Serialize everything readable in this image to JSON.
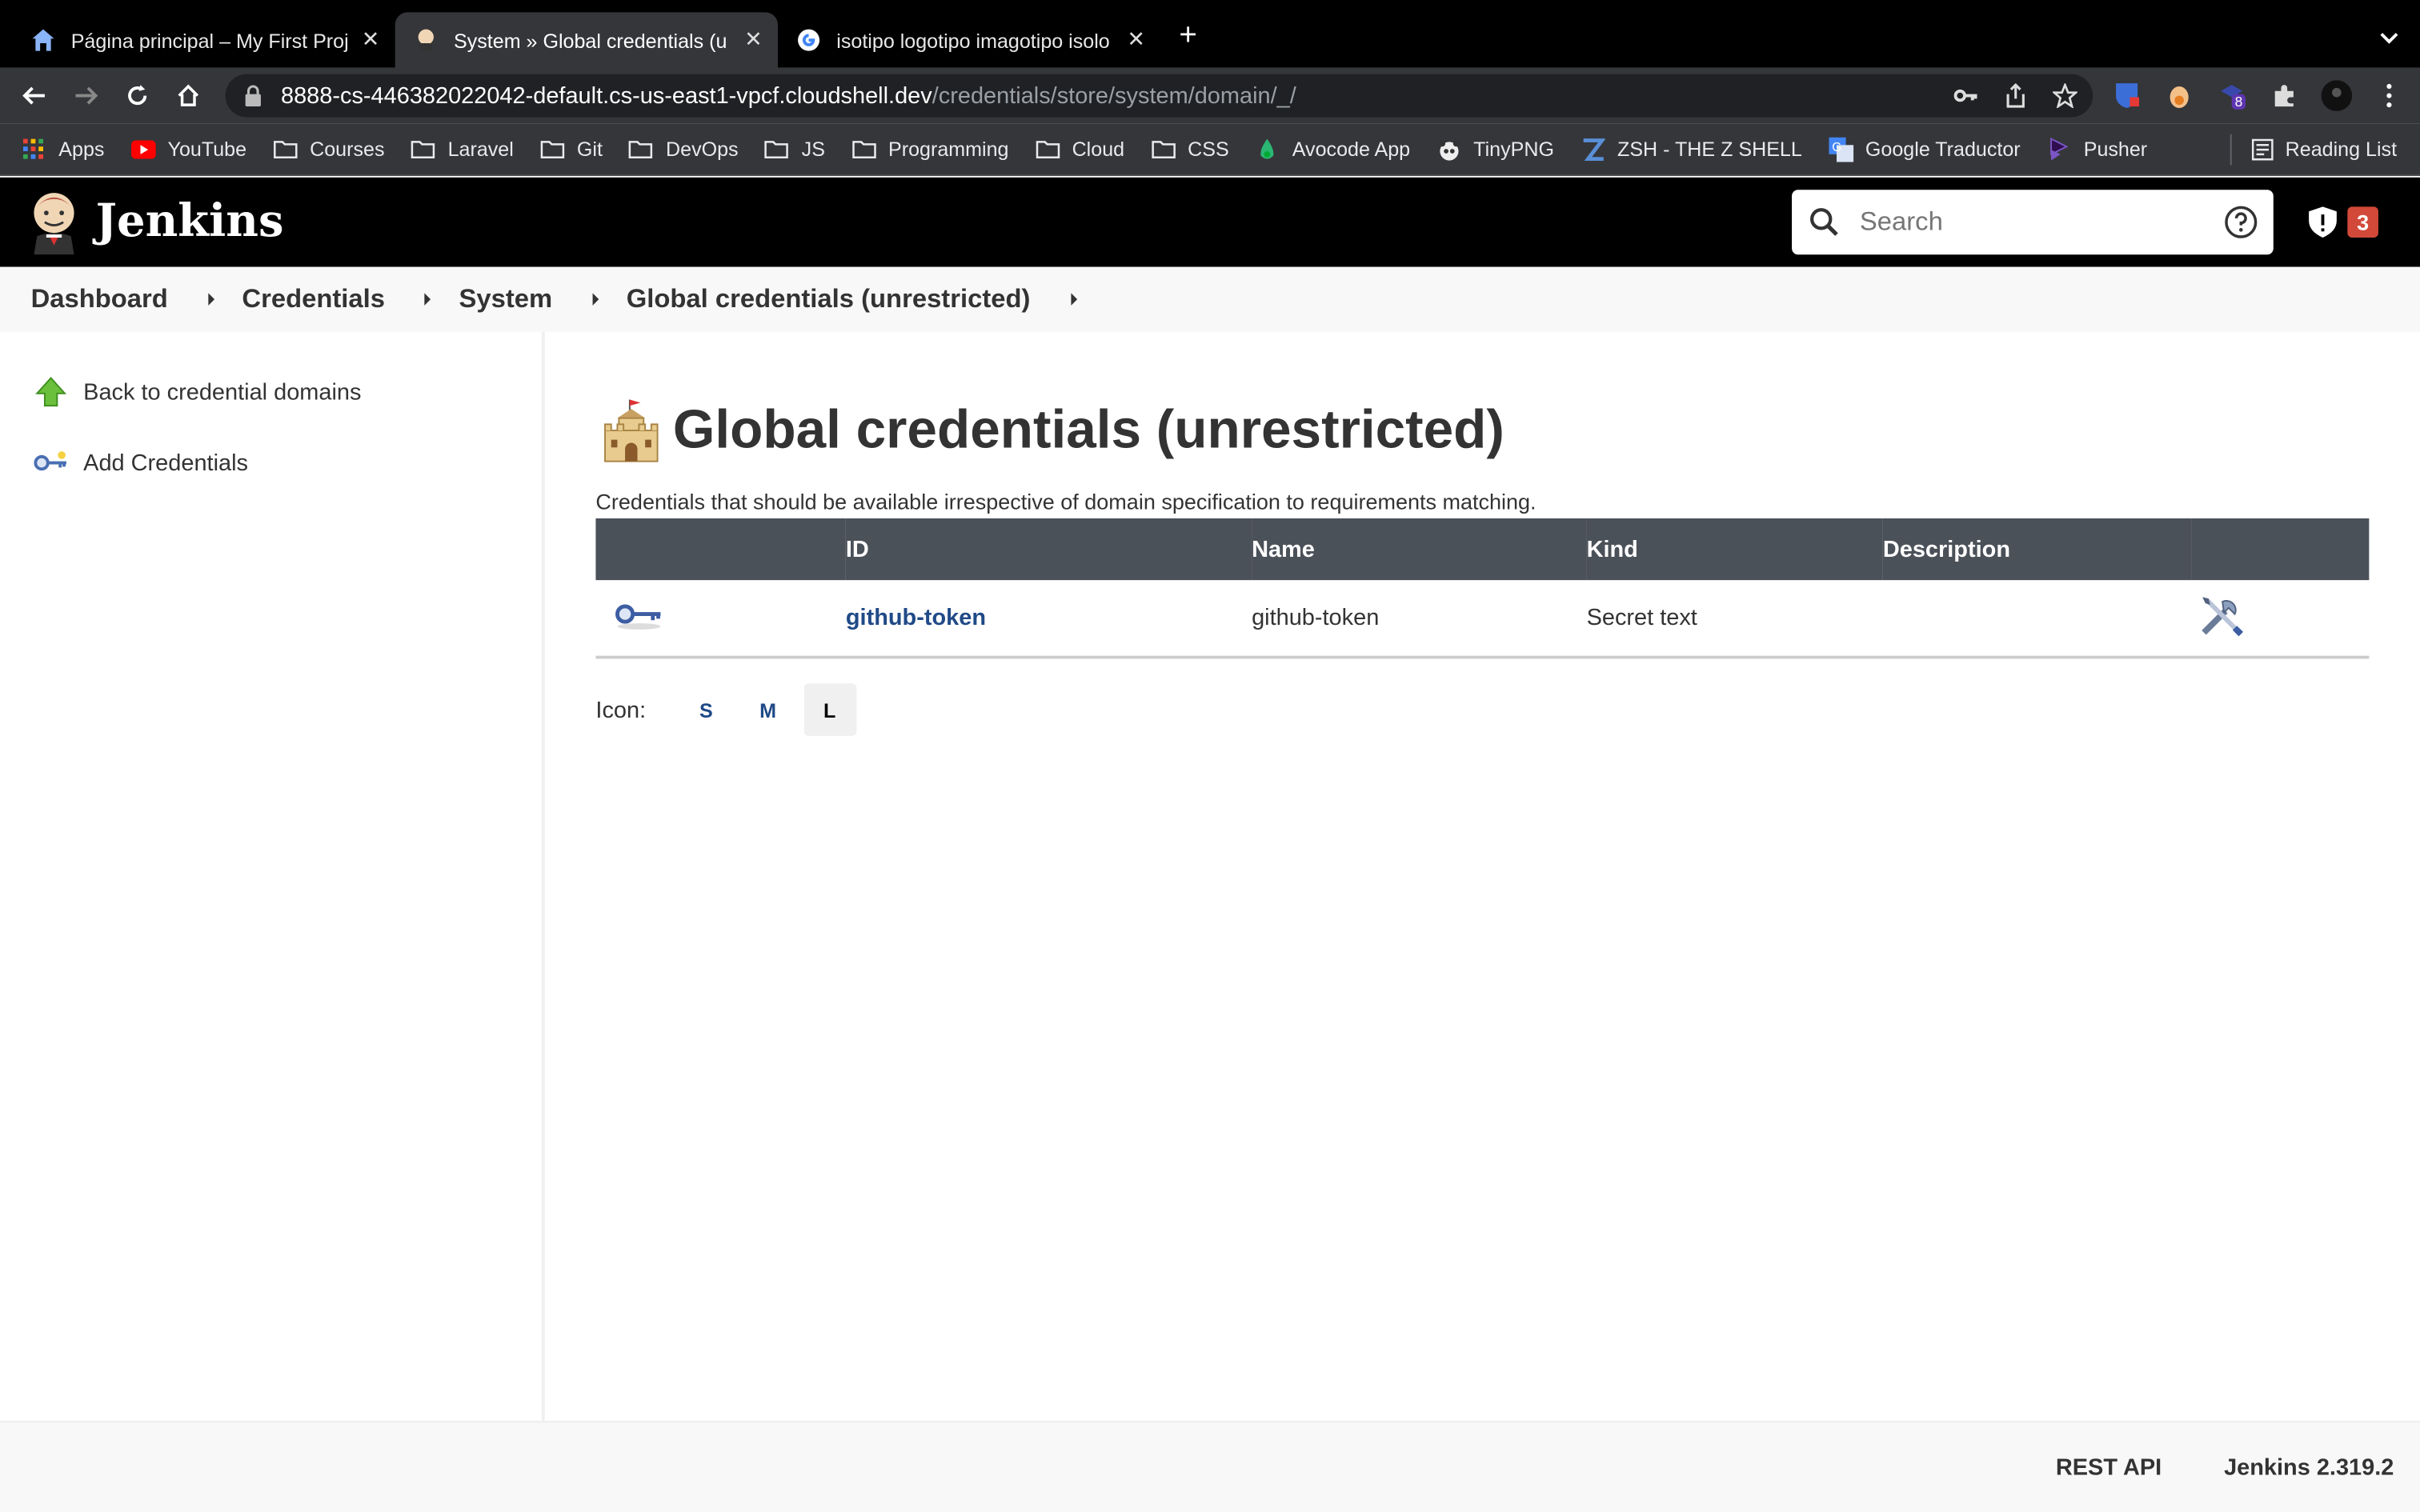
{
  "browser": {
    "tabs": [
      {
        "title": "Página principal – My First Proj",
        "icon": "home-icon"
      },
      {
        "title": "System » Global credentials (u",
        "icon": "jenkins-favicon"
      },
      {
        "title": "isotipo logotipo imagotipo isolo",
        "icon": "google-icon"
      }
    ],
    "url_host": "8888-cs-446382022042-default.cs-us-east1-vpcf.cloudshell.dev",
    "url_path": "/credentials/store/system/domain/_/",
    "extension_badge": "8",
    "bookmarks": [
      {
        "label": "Apps",
        "icon": "apps-grid-icon"
      },
      {
        "label": "YouTube",
        "icon": "youtube-icon"
      },
      {
        "label": "Courses",
        "icon": "folder-icon"
      },
      {
        "label": "Laravel",
        "icon": "folder-icon"
      },
      {
        "label": "Git",
        "icon": "folder-icon"
      },
      {
        "label": "DevOps",
        "icon": "folder-icon"
      },
      {
        "label": "JS",
        "icon": "folder-icon"
      },
      {
        "label": "Programming",
        "icon": "folder-icon"
      },
      {
        "label": "Cloud",
        "icon": "folder-icon"
      },
      {
        "label": "CSS",
        "icon": "folder-icon"
      },
      {
        "label": "Avocode App",
        "icon": "avocode-icon"
      },
      {
        "label": "TinyPNG",
        "icon": "panda-icon"
      },
      {
        "label": "ZSH - THE Z SHELL",
        "icon": "zsh-icon"
      },
      {
        "label": "Google Traductor",
        "icon": "translate-icon"
      },
      {
        "label": "Pusher",
        "icon": "pusher-icon"
      }
    ],
    "reading_list": "Reading List"
  },
  "header": {
    "title": "Jenkins",
    "search_placeholder": "Search",
    "security_count": "3"
  },
  "breadcrumbs": [
    "Dashboard",
    "Credentials",
    "System",
    "Global credentials (unrestricted)"
  ],
  "sidebar": {
    "items": [
      {
        "label": "Back to credential domains",
        "icon": "up-arrow-icon"
      },
      {
        "label": "Add Credentials",
        "icon": "key-icon"
      }
    ]
  },
  "main": {
    "title": "Global credentials (unrestricted)",
    "description": "Credentials that should be available irrespective of domain specification to requirements matching.",
    "columns": [
      "ID",
      "Name",
      "Kind",
      "Description"
    ],
    "rows": [
      {
        "id": "github-token",
        "name": "github-token",
        "kind": "Secret text",
        "description": ""
      }
    ],
    "icon_label": "Icon:",
    "icon_sizes": [
      "S",
      "M",
      "L"
    ],
    "icon_size_selected": "L"
  },
  "footer": {
    "rest_api": "REST API",
    "version": "Jenkins 2.319.2"
  },
  "colors": {
    "header_bg": "#000000",
    "table_header_bg": "#4b5159",
    "link": "#204a87",
    "badge": "#d24939"
  }
}
